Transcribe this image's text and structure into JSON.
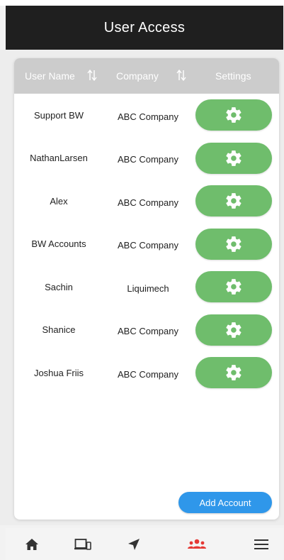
{
  "header": {
    "title": "User Access"
  },
  "table": {
    "columns": {
      "user_name": "User Name",
      "company": "Company",
      "settings": "Settings"
    },
    "rows": [
      {
        "user": "Support BW",
        "company": "ABC Company"
      },
      {
        "user": "NathanLarsen",
        "company": "ABC Company"
      },
      {
        "user": "Alex",
        "company": "ABC Company"
      },
      {
        "user": "BW Accounts",
        "company": "ABC Company"
      },
      {
        "user": "Sachin",
        "company": "Liquimech"
      },
      {
        "user": "Shanice",
        "company": "ABC Company"
      },
      {
        "user": "Joshua Friis",
        "company": "ABC Company"
      }
    ]
  },
  "actions": {
    "add_account_label": "Add Account"
  },
  "bottom_nav": {
    "items": [
      {
        "icon": "home-icon",
        "active": false
      },
      {
        "icon": "devices-icon",
        "active": false
      },
      {
        "icon": "navigation-icon",
        "active": false
      },
      {
        "icon": "users-icon",
        "active": true
      },
      {
        "icon": "menu-icon",
        "active": false
      }
    ]
  },
  "colors": {
    "app_bar": "#1f1f1f",
    "header_row": "#cccccc",
    "settings_button": "#6fbd6c",
    "add_account_button": "#2f97ea",
    "active_nav": "#e53935",
    "nav_icon": "#333333"
  }
}
